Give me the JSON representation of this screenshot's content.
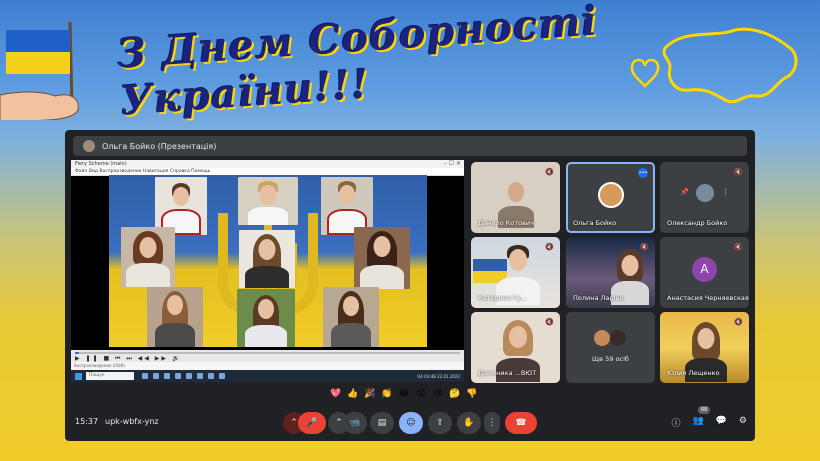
{
  "banner": {
    "title": "З Днем Соборності України!!!"
  },
  "meet": {
    "presenter_label": "Ольга Бойко (Презентація)",
    "screen_share": {
      "window_title": "Fiery Scheme (main)",
      "menu": "Файл  Вид  Воспроизведение  Навигация  Справка  Помощь",
      "status_text": "Воспроизведение (0/88)",
      "taskbar_search": "Пошук",
      "tray_text": "UA  03:48  22.01.2022",
      "seek_progress": 0.01
    },
    "participants": [
      {
        "name": "Данило Котович",
        "muted": true
      },
      {
        "name": "Ольга Бойко",
        "muted": false,
        "speaking": true
      },
      {
        "name": "Олександр Бойко",
        "muted": true
      },
      {
        "name": "Катерина Гу...",
        "muted": true
      },
      {
        "name": "Полина Ларіна",
        "muted": true
      },
      {
        "name": "Анастасия Черняевская",
        "muted": true,
        "avatar_letter": "А",
        "avatar_color": "#8e44ad"
      },
      {
        "name": "Доминика ...ВЮТ",
        "muted": true
      },
      {
        "name": "Ще 59 осіб",
        "muted": false
      },
      {
        "name": "Юлия Лещенко",
        "muted": true
      }
    ],
    "reactions": [
      "💖",
      "👍",
      "🎉",
      "👏",
      "😂",
      "😮",
      "😢",
      "🤔",
      "👎"
    ],
    "bottom_bar": {
      "time": "15:37",
      "meeting_code": "upk-wbfx-ynz",
      "participant_count": "68"
    }
  }
}
